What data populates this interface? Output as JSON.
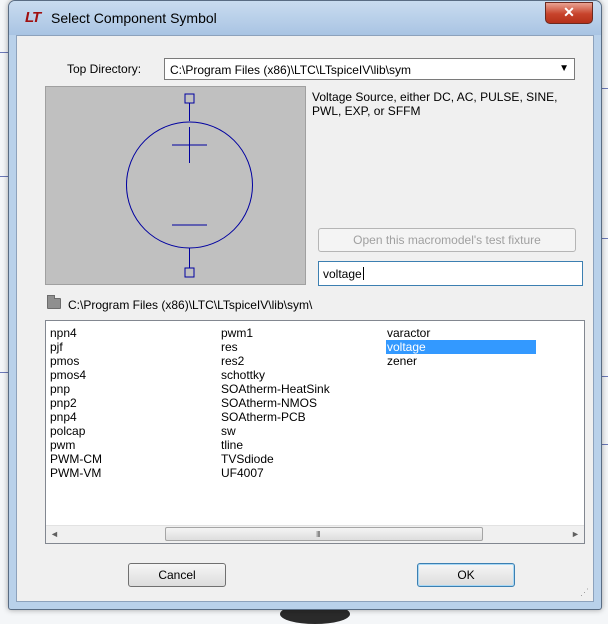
{
  "window": {
    "title": "Select Component Symbol",
    "app_icon_text": "LT",
    "close_glyph": "✕"
  },
  "top_directory": {
    "label": "Top Directory:",
    "value": "C:\\Program Files (x86)\\LTC\\LTspiceIV\\lib\\sym",
    "dropdown_glyph": "▼"
  },
  "preview": {
    "symbol": "voltage-source-symbol",
    "stroke_color": "#0000a0",
    "background_color": "#c0c0c0"
  },
  "description": "Voltage Source, either DC, AC, PULSE, SINE, PWL, EXP, or SFFM",
  "fixture_button_label": "Open this macromodel's test fixture",
  "search": {
    "value": "voltage"
  },
  "current_path": "C:\\Program Files (x86)\\LTC\\LTspiceIV\\lib\\sym\\",
  "list": {
    "columns": [
      [
        "npn4",
        "pjf",
        "pmos",
        "pmos4",
        "pnp",
        "pnp2",
        "pnp4",
        "polcap",
        "pwm",
        "PWM-CM",
        "PWM-VM"
      ],
      [
        "pwm1",
        "res",
        "res2",
        "schottky",
        "SOAtherm-HeatSink",
        "SOAtherm-NMOS",
        "SOAtherm-PCB",
        "sw",
        "tline",
        "TVSdiode",
        "UF4007"
      ],
      [
        "varactor",
        "voltage",
        "zener"
      ]
    ],
    "selected": "voltage",
    "selection_color": "#3399ff"
  },
  "scrollbar": {
    "left_arrow": "◄",
    "right_arrow": "►",
    "grip": "III"
  },
  "buttons": {
    "cancel_label": "Cancel",
    "ok_label": "OK"
  }
}
